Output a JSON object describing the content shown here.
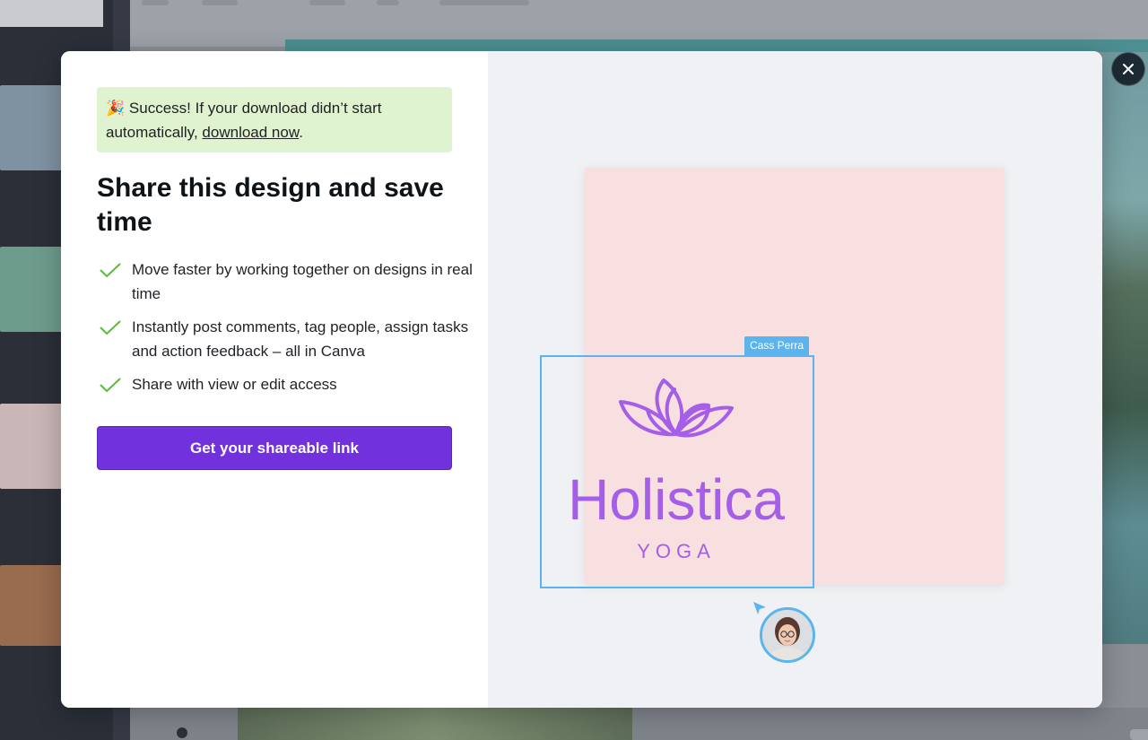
{
  "banner": {
    "emoji": "🎉",
    "text_before_link": "Success! If your download didn’t start automatically,",
    "link_text": "download now",
    "text_after_link": "."
  },
  "title": "Share this design and save time",
  "features": [
    "Move faster by working together on designs in real time",
    "Instantly post comments, tag people, assign tasks and action feedback – all in Canva",
    "Share with view or edit access"
  ],
  "cta_label": "Get your shareable link",
  "preview": {
    "collaborator_name": "Cass Perra",
    "logo_title": "Holistica",
    "logo_subtitle": "YOGA"
  },
  "colors": {
    "accent": "#7131dc",
    "success_bg": "#dff3d1",
    "check": "#5cb83f",
    "selection": "#5bb4ee",
    "logo": "#a55ee8",
    "card": "#f8dfe0"
  },
  "icons": {
    "close": "close-icon",
    "check": "check-icon",
    "cursor": "cursor-arrow-icon",
    "logo": "lotus-icon"
  }
}
